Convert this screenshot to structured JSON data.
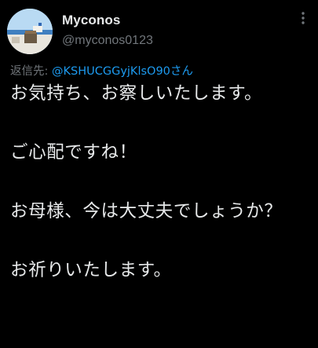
{
  "tweet": {
    "display_name": "Myconos",
    "handle": "@myconos0123",
    "reply_prefix": "返信先: ",
    "reply_target": "@KSHUCGGyjKlsO90さん",
    "paragraphs": [
      "お気持ち、お察しいたします。",
      "",
      "ご心配ですね！",
      "",
      "お母様、今は大丈夫でしょうか？",
      "",
      "お祈りいたします。"
    ]
  },
  "icons": {
    "more": "more-vertical-icon"
  },
  "colors": {
    "background": "#000000",
    "text_primary": "#e7e9ea",
    "text_secondary": "#71767b",
    "accent": "#1d9bf0"
  }
}
